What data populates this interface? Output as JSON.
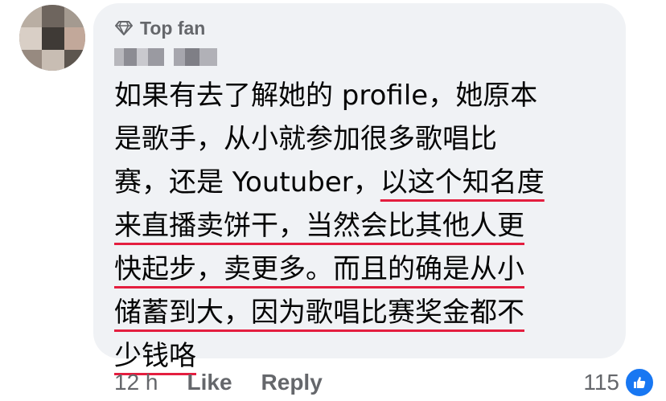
{
  "comment": {
    "badge_label": "Top fan",
    "lines": [
      {
        "plain": "如果有去了解她的 profile，她原本",
        "underlined": ""
      },
      {
        "plain": "是歌手，从小就参加很多歌唱比",
        "underlined": ""
      },
      {
        "plain": "赛，还是 Youtuber，",
        "underlined": "以这个知名度"
      },
      {
        "plain": "",
        "underlined": "来直播卖饼干，当然会比其他人更"
      },
      {
        "plain": "",
        "underlined": "快起步，卖更多。而且的确是从小"
      },
      {
        "plain": "",
        "underlined": "储蓄到大，因为歌唱比赛奖金都不"
      },
      {
        "plain": "",
        "underlined": "少钱咯"
      }
    ],
    "underline_color": "#e41e3f"
  },
  "footer": {
    "time": "12 h",
    "like_label": "Like",
    "reply_label": "Reply",
    "reaction_count": "115",
    "reaction_icon": "thumbs-up-icon"
  },
  "colors": {
    "bubble": "#f0f2f5",
    "meta_text": "#65676b",
    "like_blue": "#1877f2"
  }
}
